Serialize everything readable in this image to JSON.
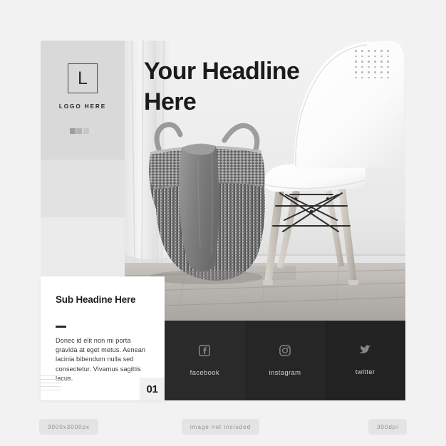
{
  "canvas": {
    "background_color": "#f2f2f2",
    "card_background": "#ffffff"
  },
  "logo_panel": {
    "mark_letter": "L",
    "caption": "LOGO HERE",
    "swatch_colors": [
      "#9e9e9e",
      "#b4b4b4",
      "#c7c7c7",
      "#dadada"
    ]
  },
  "hero": {
    "headline": "Your Headline Here",
    "dot_grid": {
      "columns": 6,
      "rows": 6,
      "dot_color": "#b8b8b8"
    },
    "photo_description": "Black and white interior photo: woven seagrass basket with draped towel beside a white Eames-style molded chair on wood flooring"
  },
  "sub_card": {
    "title": "Sub Headine Here",
    "body": "Donec id elit non mi porta gravida at eget metus. Aenean lacinia bibendum nulla sed consectetur. Vivamus sagittis lacus.",
    "number": "01"
  },
  "social": {
    "items": [
      {
        "icon": "facebook-icon",
        "label": "facebook",
        "background": "#2a2a2a"
      },
      {
        "icon": "instagram-icon",
        "label": "instagram",
        "background": "#262626"
      },
      {
        "icon": "twitter-icon",
        "label": "twitter",
        "background": "#222222"
      }
    ]
  },
  "badges": {
    "size": "3000x3000px",
    "notice": "image not included",
    "dpi": "300dpi"
  }
}
